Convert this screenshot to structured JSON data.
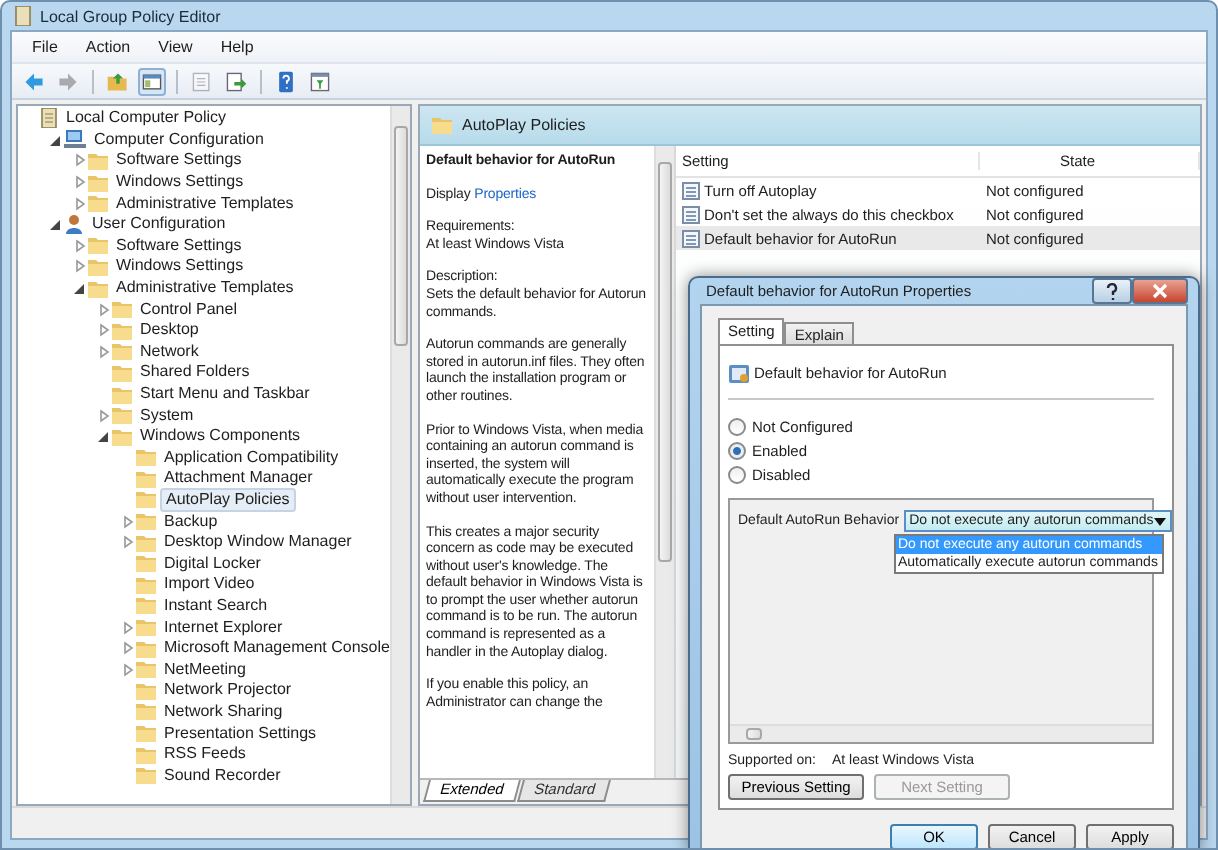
{
  "window": {
    "title": "Local Group Policy Editor"
  },
  "menu": [
    "File",
    "Action",
    "View",
    "Help"
  ],
  "toolbar": [
    [
      {
        "kind": "back",
        "pressed": false,
        "disabled": false
      },
      {
        "kind": "forward",
        "pressed": false,
        "disabled": true
      }
    ],
    [
      {
        "kind": "up",
        "pressed": false,
        "disabled": false
      },
      {
        "kind": "tree",
        "pressed": true,
        "disabled": false
      }
    ],
    [
      {
        "kind": "properties",
        "pressed": false,
        "disabled": true
      },
      {
        "kind": "export",
        "pressed": false,
        "disabled": false
      }
    ],
    [
      {
        "kind": "help",
        "pressed": false,
        "disabled": false
      },
      {
        "kind": "filter",
        "pressed": false,
        "disabled": false
      }
    ]
  ],
  "tree": [
    {
      "label": "Local Computer Policy",
      "kind": "policy",
      "selected": false,
      "children": [
        {
          "label": "Computer Configuration",
          "kind": "computer",
          "expanded": true,
          "selected": false,
          "children": [
            {
              "label": "Software Settings",
              "kind": "folder",
              "expanded": false,
              "selected": false
            },
            {
              "label": "Windows Settings",
              "kind": "folder",
              "expanded": false,
              "selected": false
            },
            {
              "label": "Administrative Templates",
              "kind": "folder",
              "expanded": false,
              "selected": false
            }
          ]
        },
        {
          "label": "User Configuration",
          "kind": "user",
          "expanded": true,
          "selected": false,
          "children": [
            {
              "label": "Software Settings",
              "kind": "folder",
              "expanded": false,
              "selected": false
            },
            {
              "label": "Windows Settings",
              "kind": "folder",
              "expanded": false,
              "selected": false
            },
            {
              "label": "Administrative Templates",
              "kind": "folder",
              "expanded": true,
              "selected": false,
              "children": [
                {
                  "label": "Control Panel",
                  "kind": "folder",
                  "expanded": false,
                  "selected": false
                },
                {
                  "label": "Desktop",
                  "kind": "folder",
                  "expanded": false,
                  "selected": false
                },
                {
                  "label": "Network",
                  "kind": "folder",
                  "expanded": false,
                  "selected": false
                },
                {
                  "label": "Shared Folders",
                  "kind": "folder",
                  "selected": false
                },
                {
                  "label": "Start Menu and Taskbar",
                  "kind": "folder",
                  "selected": false
                },
                {
                  "label": "System",
                  "kind": "folder",
                  "expanded": false,
                  "selected": false
                },
                {
                  "label": "Windows Components",
                  "kind": "folder",
                  "expanded": true,
                  "selected": false,
                  "children": [
                    {
                      "label": "Application Compatibility",
                      "kind": "folder",
                      "selected": false
                    },
                    {
                      "label": "Attachment Manager",
                      "kind": "folder",
                      "selected": false
                    },
                    {
                      "label": "AutoPlay Policies",
                      "kind": "folder",
                      "selected": true
                    },
                    {
                      "label": "Backup",
                      "kind": "folder",
                      "expanded": false,
                      "selected": false
                    },
                    {
                      "label": "Desktop Window Manager",
                      "kind": "folder",
                      "expanded": false,
                      "selected": false
                    },
                    {
                      "label": "Digital Locker",
                      "kind": "folder",
                      "selected": false
                    },
                    {
                      "label": "Import Video",
                      "kind": "folder",
                      "selected": false
                    },
                    {
                      "label": "Instant Search",
                      "kind": "folder",
                      "selected": false
                    },
                    {
                      "label": "Internet Explorer",
                      "kind": "folder",
                      "expanded": false,
                      "selected": false
                    },
                    {
                      "label": "Microsoft Management Console",
                      "kind": "folder",
                      "expanded": false,
                      "selected": false
                    },
                    {
                      "label": "NetMeeting",
                      "kind": "folder",
                      "expanded": false,
                      "selected": false
                    },
                    {
                      "label": "Network Projector",
                      "kind": "folder",
                      "selected": false
                    },
                    {
                      "label": "Network Sharing",
                      "kind": "folder",
                      "selected": false
                    },
                    {
                      "label": "Presentation Settings",
                      "kind": "folder",
                      "selected": false
                    },
                    {
                      "label": "RSS Feeds",
                      "kind": "folder",
                      "selected": false
                    },
                    {
                      "label": "Sound Recorder",
                      "kind": "folder",
                      "selected": false
                    }
                  ]
                }
              ]
            }
          ]
        }
      ]
    }
  ],
  "details": {
    "header": "AutoPlay Policies",
    "title": "Default behavior for AutoRun",
    "display_prefix": "Display",
    "display_link": "Properties",
    "sections": [
      {
        "heading": "Requirements:",
        "text": "At least Windows Vista"
      },
      {
        "heading": "Description:",
        "text": "Sets the default behavior for Autorun commands."
      }
    ],
    "paragraphs": [
      "Autorun commands are generally stored in autorun.inf files. They often launch the installation program or other routines.",
      "Prior to Windows Vista, when media containing an autorun command is inserted, the system will automatically execute the program without user intervention.",
      "This creates a major security concern as code may be executed without user's knowledge. The default behavior in Windows Vista is to prompt the user whether autorun command is to be run. The autorun command is represented as a handler in the Autoplay dialog.",
      "If you enable this policy, an Administrator can change the"
    ]
  },
  "list": {
    "columns": [
      "Setting",
      "State"
    ],
    "rows": [
      {
        "setting": "Turn off Autoplay",
        "state": "Not configured",
        "selected": false
      },
      {
        "setting": "Don't set the always do this checkbox",
        "state": "Not configured",
        "selected": false
      },
      {
        "setting": "Default behavior for AutoRun",
        "state": "Not configured",
        "selected": true
      }
    ]
  },
  "view_tabs": [
    {
      "label": "Extended",
      "selected": true
    },
    {
      "label": "Standard",
      "selected": false
    }
  ],
  "dialog": {
    "title": "Default behavior for AutoRun Properties",
    "tabs": [
      {
        "label": "Setting",
        "selected": true
      },
      {
        "label": "Explain",
        "selected": false
      }
    ],
    "policy_name": "Default behavior for AutoRun",
    "radios": [
      {
        "label": "Not Configured",
        "selected": false
      },
      {
        "label": "Enabled",
        "selected": true
      },
      {
        "label": "Disabled",
        "selected": false
      }
    ],
    "option": {
      "label": "Default AutoRun Behavior",
      "value": "Do not execute any autorun commands",
      "options": [
        {
          "label": "Do not execute any autorun commands",
          "selected": true
        },
        {
          "label": "Automatically execute autorun commands",
          "selected": false
        }
      ]
    },
    "supported_label": "Supported on:",
    "supported_value": "At least Windows Vista",
    "nav_buttons": [
      {
        "label": "Previous Setting",
        "disabled": false
      },
      {
        "label": "Next Setting",
        "disabled": true
      }
    ],
    "buttons": [
      {
        "label": "OK",
        "default": true
      },
      {
        "label": "Cancel",
        "default": false
      },
      {
        "label": "Apply",
        "default": false
      }
    ]
  }
}
